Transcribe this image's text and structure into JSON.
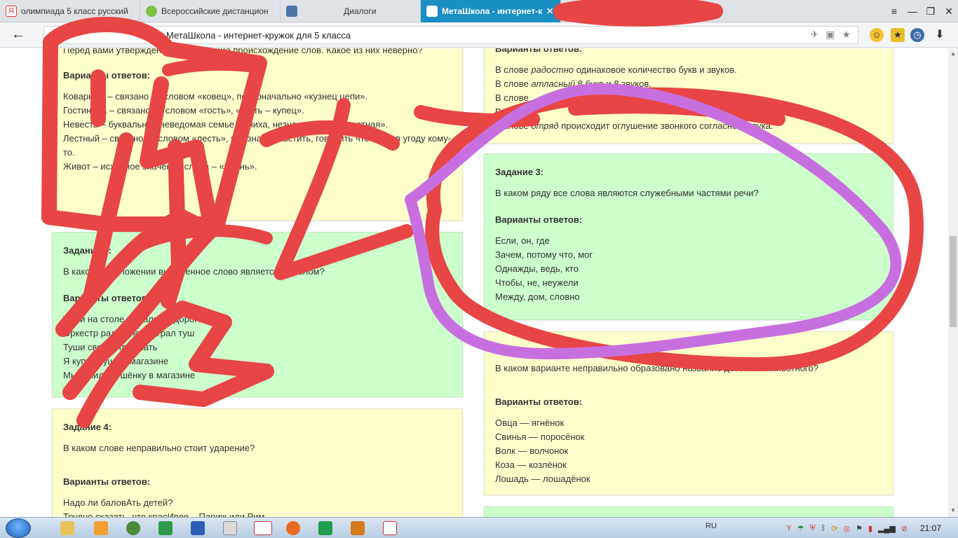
{
  "browser": {
    "tabs": [
      {
        "label": "олимпиада 5 класс русский",
        "favicon": "yandex-icon",
        "active": false
      },
      {
        "label": "Всероссийские дистанцион",
        "favicon": "leaf-icon",
        "active": false
      },
      {
        "label": "Диалоги",
        "favicon": "dialogs-icon",
        "active": false
      },
      {
        "label": "МетаШкола - интернет-к",
        "favicon": "page-icon",
        "active": true
      }
    ],
    "address": "МетаШкола - интернет-кружок для 5 класса",
    "window_controls": [
      "≡",
      "—",
      "❐",
      "✕"
    ]
  },
  "left_column": {
    "card1": {
      "question": "Перед вами утверждения, поясняющие происхождение слов. Какое из них неверно?",
      "answers_label": "Варианты ответов:",
      "options": [
        "Коварный – связано со словом «ковец», первоначально «кузнец цепи».",
        "Гостиница – связано со словом «гость», «гость – купец».",
        "Невеста – буквально «неведомая семье жениха, незнакомая, неизвестная».",
        "Лестный – связано со словом «лесть», что значит льстить, говорить что-либо в угоду кому-то.",
        "Живот – исходное значение слова – «жизнь»."
      ]
    },
    "card2": {
      "title": "Задание 2:",
      "question": "В каком предложении выделенное слово является глаголом?",
      "answers_label": "Варианты ответов:",
      "options": [
        "Туши на столе лежали на дороге",
        "Оркестр радостно заиграл туш",
        "Туши свет и иди спать",
        "Я купил тушь в магазине",
        "Мы купили тушёнку в магазине"
      ]
    },
    "card3": {
      "title": "Задание 4:",
      "question": "В каком слове неправильно стоит ударение?",
      "answers_label": "Варианты ответов:",
      "options": [
        "Надо ли баловАть детей?",
        "Трудно сказать, что красИвее – Париж или Рим"
      ]
    }
  },
  "right_column": {
    "card1": {
      "answers_label": "Варианты ответов:",
      "options": [
        {
          "pre": "В слове ",
          "em": "радостно",
          "post": " одинаковое количество букв и звуков."
        },
        {
          "pre": "В слове ",
          "em": "атласный",
          "post": " 8 букв и 8 звуков."
        },
        {
          "pre": "В слове ",
          "em": "",
          "post": ""
        },
        {
          "pre": "В слове ",
          "em": "",
          "post": ""
        },
        {
          "pre": "В слове ",
          "em": "отряд",
          "post": " происходит оглушение звонкого согласного звука."
        }
      ]
    },
    "card2": {
      "title": "Задание 3:",
      "question": "В каком ряду все слова являются служебными частями речи?",
      "answers_label": "Варианты ответов:",
      "options": [
        "Если, он, где",
        "Зачем, потому что, мог",
        "Однажды, ведь, кто",
        "Чтобы, не, неужели",
        "Между, дом, словно"
      ]
    },
    "card3": {
      "question": "В каком варианте неправильно образовано название детёныша животного?",
      "answers_label": "Варианты ответов:",
      "options": [
        "Овца — ягнёнок",
        "Свинья — поросёнок",
        "Волк — волчонок",
        "Коза — козлёнок",
        "Лошадь — лошадёнок"
      ]
    }
  },
  "taskbar": {
    "lang": "RU",
    "clock": "21:07"
  },
  "colors": {
    "yellow_card": "#ffffcc",
    "green_card": "#ccffcc",
    "active_tab": "#1b8fc3",
    "scribble_red": "#e84545",
    "scribble_purple": "#c86fe0"
  }
}
